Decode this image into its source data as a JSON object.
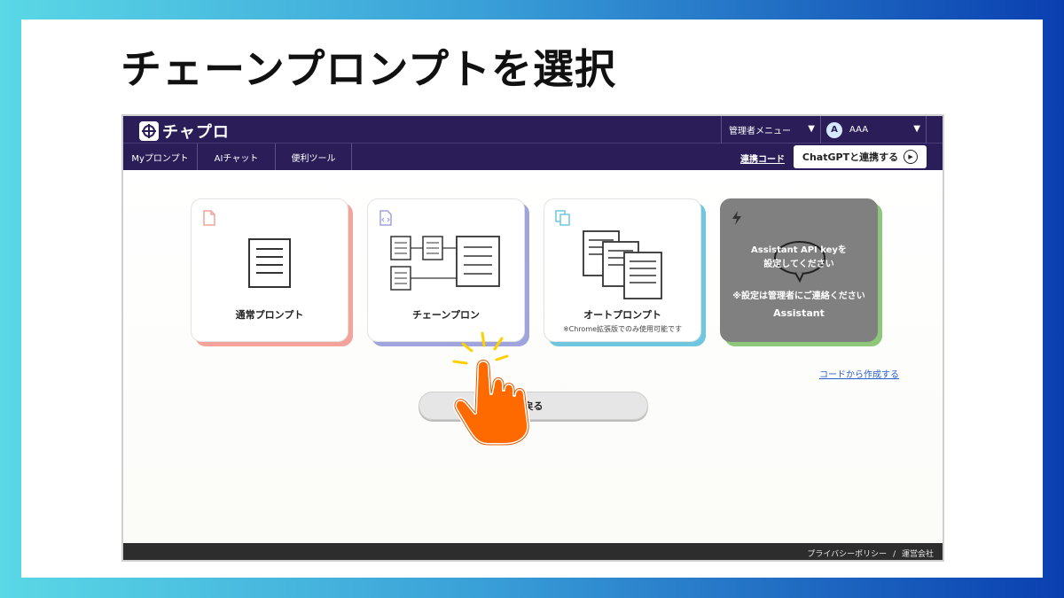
{
  "slide_title": "チェーンプロンプトを選択",
  "app": {
    "logo_text": "チャプロ",
    "header": {
      "admin_menu_label": "管理者メニュー",
      "user_avatar_initial": "A",
      "user_name": "AAA"
    },
    "nav": {
      "items": [
        {
          "label": "Myプロンプト"
        },
        {
          "label": "AIチャット"
        },
        {
          "label": "便利ツール"
        }
      ],
      "link_code_label": "連携コード",
      "chatgpt_button_label": "ChatGPTと連携する"
    },
    "cards": [
      {
        "label": "通常プロンプト",
        "sub": "",
        "accent": "#f4a39a"
      },
      {
        "label": "チェーンプロン",
        "sub": "",
        "accent": "#9fa4dd"
      },
      {
        "label": "オートプロンプト",
        "sub": "※Chrome拡張版でのみ使用可能です",
        "accent": "#6ec7de"
      },
      {
        "label": "Assistant",
        "overlay_line1": "Assistant API keyを",
        "overlay_line2": "設定してください",
        "overlay_note": "※設定は管理者にご連絡ください",
        "accent": "#8fc77a"
      }
    ],
    "code_create_link": "コードから作成する",
    "back_button_label": "戻る",
    "footer": {
      "privacy": "プライバシーポリシー",
      "separator": "/",
      "company": "運営会社"
    }
  },
  "colors": {
    "header_bg": "#2a1d58",
    "hand": "#ff6a00",
    "spark": "#ffd000"
  }
}
